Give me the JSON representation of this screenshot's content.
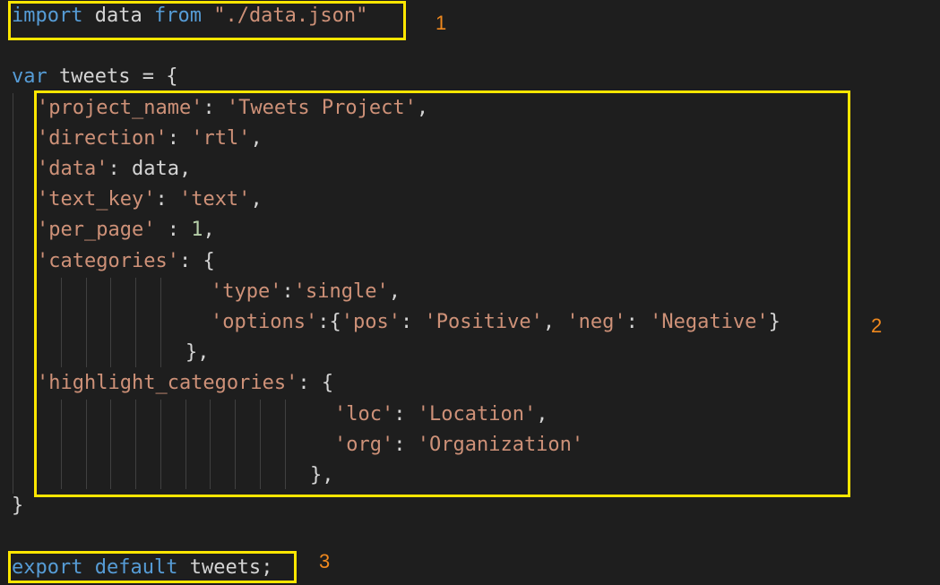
{
  "code": {
    "import_kw": "import",
    "import_name": "data",
    "from_kw": "from",
    "import_path": "\"./data.json\"",
    "var_kw": "var",
    "var_name": "tweets",
    "assign": " = {",
    "k_project_name": "'project_name'",
    "v_project_name": "'Tweets Project'",
    "k_direction": "'direction'",
    "v_direction": "'rtl'",
    "k_data": "'data'",
    "v_data": "data",
    "k_text_key": "'text_key'",
    "v_text_key": "'text'",
    "k_per_page": "'per_page'",
    "v_per_page": "1",
    "k_categories": "'categories'",
    "k_type": "'type'",
    "v_type": "'single'",
    "k_options": "'options'",
    "k_pos": "'pos'",
    "v_pos": "'Positive'",
    "k_neg": "'neg'",
    "v_neg": "'Negative'",
    "k_highlight_categories": "'highlight_categories'",
    "k_loc": "'loc'",
    "v_loc": "'Location'",
    "k_org": "'org'",
    "v_org": "'Organization'",
    "close_brace": "}",
    "close_obj": "},",
    "export_kw": "export",
    "default_kw": "default",
    "export_name": "tweets",
    "semicolon": ";"
  },
  "annotations": {
    "marker_1": "1",
    "marker_2": "2",
    "marker_3": "3",
    "box_color": "#ffe600",
    "marker_color": "#f0891e"
  },
  "colors": {
    "background": "#1e1e1e",
    "keyword": "#569cd6",
    "string": "#ce9178",
    "number": "#b5cea8",
    "text": "#d4d4d4"
  }
}
